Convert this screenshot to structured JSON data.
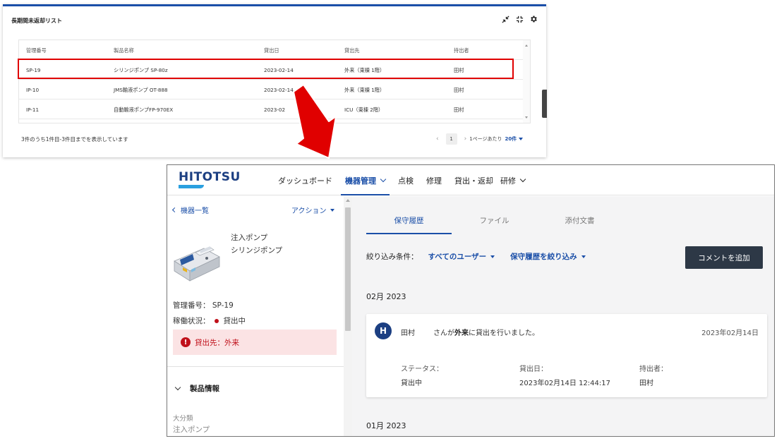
{
  "list_card": {
    "title": "長期間未返却リスト",
    "columns": [
      "管理番号",
      "製品名称",
      "貸出日",
      "貸出先",
      "持出者"
    ],
    "rows": [
      {
        "id": "SP-19",
        "product": "シリンジポンプ SP-80z",
        "date": "2023-02-14",
        "dest": "外来（東棟 1階）",
        "by": "田村"
      },
      {
        "id": "IP-10",
        "product": "JMS輸液ポンプ OT-888",
        "date": "2023-02-14",
        "dest": "外来（東棟 1階）",
        "by": "田村"
      },
      {
        "id": "IP-11",
        "product": "自動輸液ポンプFP-970EX",
        "date": "2023-02",
        "dest": "ICU（東棟 2階）",
        "by": "田村"
      }
    ],
    "count_text": "3件のうち1件目-3件目までを表示しています",
    "pager": {
      "prev": "‹",
      "page": "1",
      "next": "›",
      "per_page_label": "1ページあたり",
      "per_page_value": "20件"
    },
    "icons": [
      "collapse-icon",
      "fullscreen-icon",
      "gear-icon"
    ]
  },
  "annotation": {
    "arrow_color": "#e00000",
    "highlight_color": "#e00000"
  },
  "app": {
    "logo": "HITOTSU",
    "nav": [
      {
        "label": "ダッシュボード",
        "active": false,
        "dropdown": false
      },
      {
        "label": "機器管理",
        "active": true,
        "dropdown": true
      },
      {
        "label": "点検",
        "active": false,
        "dropdown": false
      },
      {
        "label": "修理",
        "active": false,
        "dropdown": false
      },
      {
        "label": "貸出・返却",
        "active": false,
        "dropdown": false
      },
      {
        "label": "研修",
        "active": false,
        "dropdown": true
      }
    ],
    "left": {
      "back_label": "機器一覧",
      "action_label": "アクション",
      "product_category": "注入ポンプ",
      "product_name": "シリンジポンプ",
      "mgmt_no": "管理番号： SP-19",
      "op_status_label": "稼働状況：",
      "op_status_value": "貸出中",
      "alert_text": "貸出先：外来",
      "section_title": "製品情報",
      "category_label": "大分類",
      "category_value": "注入ポンプ"
    },
    "right": {
      "tabs": [
        "保守履歴",
        "ファイル",
        "添付文書"
      ],
      "filter_label": "絞り込み条件：",
      "filter_user": "すべてのユーザー",
      "filter_history": "保守履歴を絞り込み",
      "add_comment": "コメントを追加",
      "month_1": "02月 2023",
      "month_2": "01月 2023",
      "history": {
        "avatar": "H",
        "user": "田村",
        "msg_pre": "さんが",
        "msg_bold": "外来",
        "msg_post": "に貸出を行いました。",
        "date": "2023年02月14日",
        "status_label": "ステータス：",
        "status_value": "貸出中",
        "lend_date_label": "貸出日：",
        "lend_date_value": "2023年02月14日 12:44:17",
        "holder_label": "持出者：",
        "holder_value": "田村"
      }
    },
    "colors": {
      "primary": "#1b4fa8",
      "logo": "#1c3f82",
      "accent": "#2aa0e0",
      "alert_bg": "#fbe3e4",
      "alert_fg": "#c0101a",
      "button": "#2d3846"
    }
  }
}
